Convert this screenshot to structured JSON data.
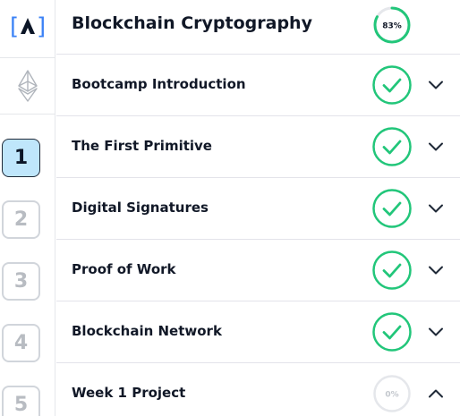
{
  "logo": {
    "text": "[▲]"
  },
  "course": {
    "title": "Blockchain Cryptography",
    "progress_text": "83%",
    "progress_value": 0.83
  },
  "weeks": [
    {
      "label": "1",
      "active": true
    },
    {
      "label": "2",
      "active": false
    },
    {
      "label": "3",
      "active": false
    },
    {
      "label": "4",
      "active": false
    },
    {
      "label": "5",
      "active": false
    }
  ],
  "modules": [
    {
      "title": "Bootcamp Introduction",
      "status": "complete",
      "expanded": false
    },
    {
      "title": "The First Primitive",
      "status": "complete",
      "expanded": false
    },
    {
      "title": "Digital Signatures",
      "status": "complete",
      "expanded": false
    },
    {
      "title": "Proof of Work",
      "status": "complete",
      "expanded": false
    },
    {
      "title": "Blockchain Network",
      "status": "complete",
      "expanded": false
    },
    {
      "title": "Week 1 Project",
      "status": "not-started",
      "progress_text": "0%",
      "progress_value": 0,
      "expanded": true
    }
  ],
  "icons": {
    "logo": "brand-logo-icon",
    "ethereum": "ethereum-icon",
    "complete": "check-circle-icon",
    "collapsed": "chevron-down-icon",
    "expanded": "chevron-up-icon"
  },
  "colors": {
    "complete": "#22c67a",
    "progress_track": "#e5e7eb",
    "progress_fill": "#22c67a",
    "active_week_bg": "#bfe6fb",
    "logo_blue": "#3b82f6"
  }
}
